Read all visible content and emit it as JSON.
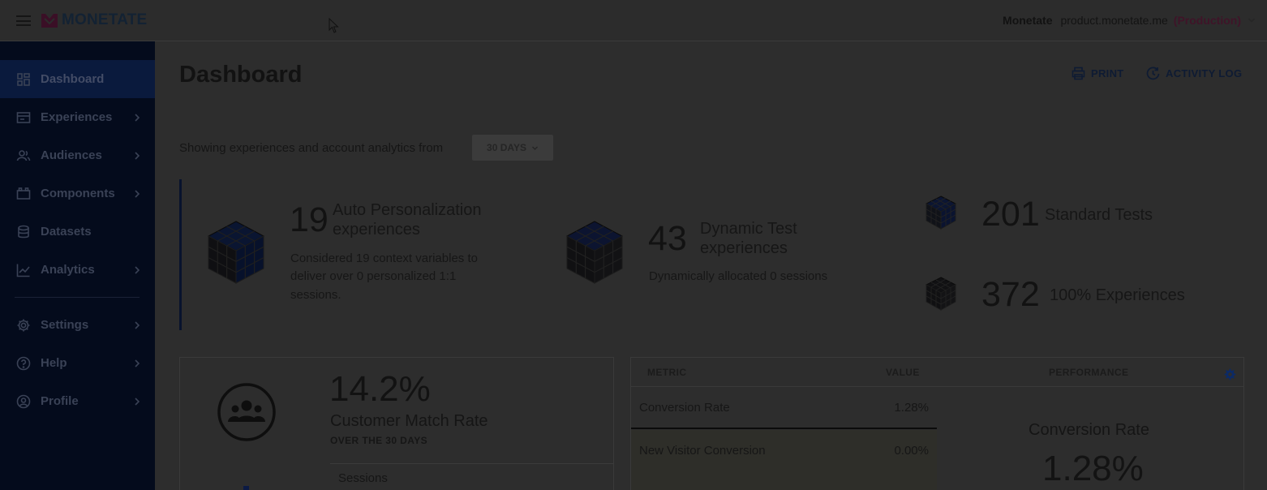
{
  "brand": {
    "name": "MONETATE"
  },
  "account": {
    "name": "Monetate",
    "host": "product.monetate.me",
    "environment": "(Production)"
  },
  "sidebar": {
    "items": [
      {
        "label": "Dashboard",
        "icon": "dashboard-icon",
        "active": true
      },
      {
        "label": "Experiences",
        "icon": "experiences-icon"
      },
      {
        "label": "Audiences",
        "icon": "audiences-icon"
      },
      {
        "label": "Components",
        "icon": "components-icon"
      },
      {
        "label": "Datasets",
        "icon": "datasets-icon"
      },
      {
        "label": "Analytics",
        "icon": "analytics-icon"
      },
      {
        "label": "Settings",
        "icon": "gear-icon"
      },
      {
        "label": "Help",
        "icon": "help-icon"
      },
      {
        "label": "Profile",
        "icon": "profile-icon"
      }
    ]
  },
  "page": {
    "title": "Dashboard",
    "print_label": "PRINT",
    "activity_log_label": "ACTIVITY LOG"
  },
  "filter": {
    "prefix": "Showing experiences and account analytics from",
    "range": "30 DAYS"
  },
  "summary": {
    "auto_personalization": {
      "count": "19",
      "label_line1": "Auto Personalization",
      "label_line2": "experiences",
      "desc_line1": "Considered 19 context variables to",
      "desc_line2": "deliver over 0 personalized 1:1",
      "desc_line3": "sessions."
    },
    "dynamic_test": {
      "count": "43",
      "label_line1": "Dynamic Test",
      "label_line2": "experiences",
      "desc": "Dynamically allocated 0 sessions"
    },
    "standard_tests": {
      "count": "201",
      "label": "Standard Tests"
    },
    "hundred_percent": {
      "count": "372",
      "label": "100% Experiences"
    }
  },
  "customer_match": {
    "rate": "14.2%",
    "label": "Customer Match Rate",
    "sub": "OVER THE 30 DAYS",
    "sessions_label": "Sessions"
  },
  "metrics": {
    "headers": {
      "metric": "METRIC",
      "value": "VALUE",
      "performance": "PERFORMANCE"
    },
    "rows": [
      {
        "metric": "Conversion Rate",
        "value": "1.28%"
      },
      {
        "metric": "New Visitor Conversion",
        "value": "0.00%"
      }
    ],
    "performance": {
      "title": "Conversion Rate",
      "value": "1.28%"
    }
  },
  "colors": {
    "brand_mark": "#3a0f26",
    "sidebar_bg": "#040b1c",
    "overlay_bg": "#2d2d2d",
    "environment": "#3f1428"
  }
}
